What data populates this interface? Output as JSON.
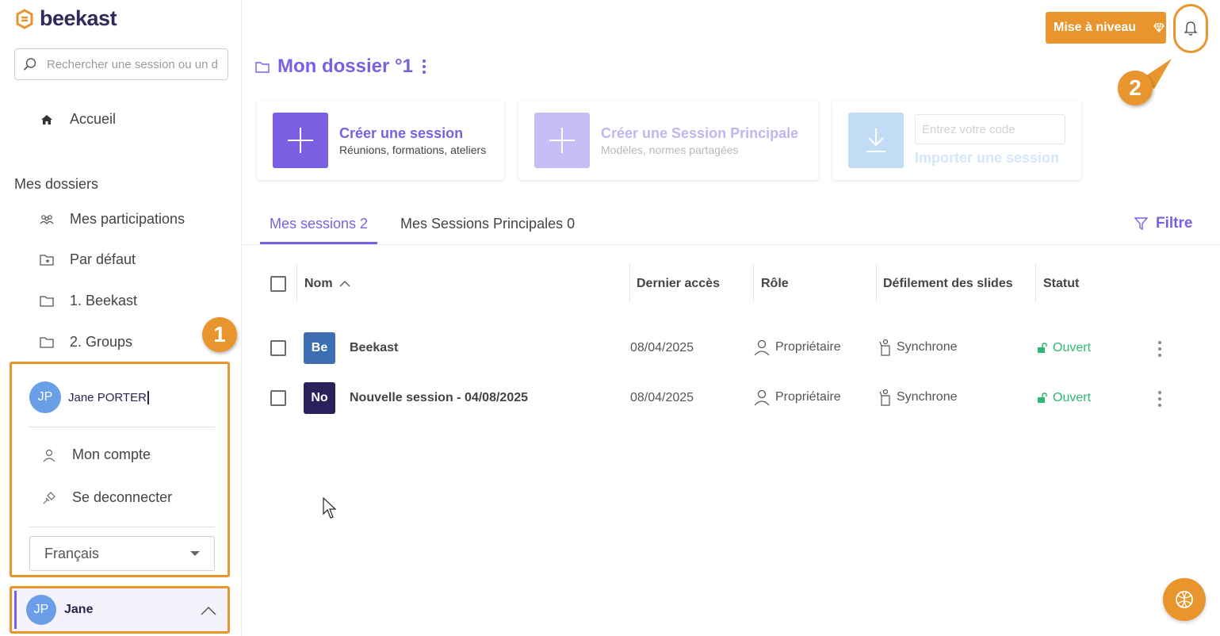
{
  "brand": {
    "name": "beekast",
    "accent": "#7b5fe3",
    "orange": "#e9952d"
  },
  "sidebar": {
    "search_placeholder": "Rechercher une session ou un dossier",
    "home_label": "Accueil",
    "folders_title": "Mes dossiers",
    "folders": [
      {
        "label": "Mes participations",
        "icon": "people-icon"
      },
      {
        "label": "Par défaut",
        "icon": "folder-star-icon"
      },
      {
        "label": "1. Beekast",
        "icon": "folder-icon"
      },
      {
        "label": "2. Groups",
        "icon": "folder-icon"
      }
    ]
  },
  "user_menu": {
    "initials": "JP",
    "full_name": "Jane PORTER",
    "account_label": "Mon compte",
    "logout_label": "Se deconnecter",
    "language": "Français",
    "short_name": "Jane"
  },
  "markers": {
    "one": "1",
    "two": "2"
  },
  "header": {
    "upgrade_label": "Mise à niveau"
  },
  "folder": {
    "title": "Mon dossier °1"
  },
  "cards": {
    "create_session": {
      "title": "Créer une session",
      "subtitle": "Réunions, formations, ateliers"
    },
    "create_master": {
      "title": "Créer une Session Principale",
      "subtitle": "Modèles, normes partagées"
    },
    "import": {
      "placeholder": "Entrez votre code",
      "title": "Importer une session"
    }
  },
  "tabs": [
    {
      "label": "Mes sessions 2"
    },
    {
      "label": "Mes Sessions Principales 0"
    }
  ],
  "filter_label": "Filtre",
  "table": {
    "headers": {
      "name": "Nom",
      "last_access": "Dernier accès",
      "role": "Rôle",
      "scroll": "Défilement des slides",
      "status": "Statut"
    },
    "rows": [
      {
        "badge": "Be",
        "badge_color": "#3d6eb4",
        "name": "Beekast",
        "last_access": "08/04/2025",
        "role": "Propriétaire",
        "scroll": "Synchrone",
        "status": "Ouvert"
      },
      {
        "badge": "No",
        "badge_color": "#2b1f5c",
        "name": "Nouvelle session - 04/08/2025",
        "last_access": "08/04/2025",
        "role": "Propriétaire",
        "scroll": "Synchrone",
        "status": "Ouvert"
      }
    ]
  }
}
